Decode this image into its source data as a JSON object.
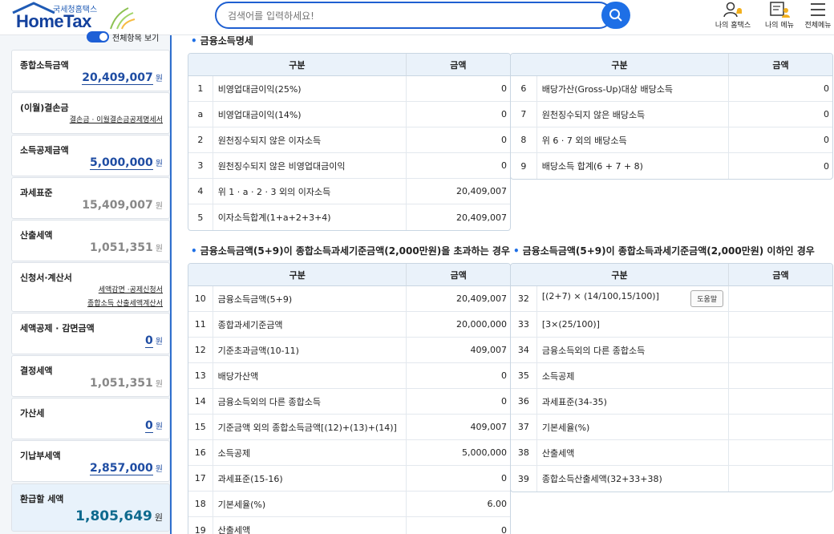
{
  "header": {
    "logo_sub": "국세청홈택스",
    "logo_main": "HomeTax",
    "search_placeholder": "검색어를 입력하세요!",
    "nav": [
      {
        "label": "나의 홈택스",
        "icon": "user-bell-icon"
      },
      {
        "label": "나의 메뉴",
        "icon": "menu-book-user-icon"
      },
      {
        "label": "전체메뉴",
        "icon": "hamburger-menu-icon"
      }
    ]
  },
  "sidebar": {
    "toggle_label": "전체항목 보기",
    "toggle_on": true,
    "cards": [
      {
        "title": "종합소득금액",
        "value": "20,409,007",
        "unit": "원",
        "style": "blue"
      },
      {
        "title": "(이월)결손금",
        "links": [
          "결손금 · 이월결손금공제명세서"
        ]
      },
      {
        "title": "소득공제금액",
        "value": "5,000,000",
        "unit": "원",
        "style": "blue"
      },
      {
        "title": "과세표준",
        "value": "15,409,007",
        "unit": "원",
        "style": "gray"
      },
      {
        "title": "산출세액",
        "value": "1,051,351",
        "unit": "원",
        "style": "gray"
      },
      {
        "title": "신청서·계산서",
        "links": [
          "세액감면 ·공제신청서",
          "종합소득 산출세액계산서"
        ]
      },
      {
        "title": "세액공제 · 감면금액",
        "value": "0",
        "unit": "원",
        "style": "blue"
      },
      {
        "title": "결정세액",
        "value": "1,051,351",
        "unit": "원",
        "style": "gray"
      },
      {
        "title": "가산세",
        "value": "0",
        "unit": "원",
        "style": "blue"
      },
      {
        "title": "기납부세액",
        "value": "2,857,000",
        "unit": "원",
        "style": "blue"
      },
      {
        "title": "환급할 세액",
        "value": "1,805,649",
        "unit": "원",
        "style": "highlight"
      }
    ]
  },
  "main": {
    "section1": {
      "title": "금융소득명세",
      "headers": [
        "구분",
        "금액",
        "구분",
        "금액"
      ],
      "left_rows": [
        {
          "no": "1",
          "label": "비영업대금이익(25%)",
          "amount": "0"
        },
        {
          "no": "a",
          "label": "비영업대금이익(14%)",
          "amount": "0"
        },
        {
          "no": "2",
          "label": "원천징수되지 않은 이자소득",
          "amount": "0"
        },
        {
          "no": "3",
          "label": "원천징수되지 않은 비영업대금이익",
          "amount": "0"
        },
        {
          "no": "4",
          "label": "위 1 · a · 2 · 3 외의 이자소득",
          "amount": "20,409,007"
        },
        {
          "no": "5",
          "label": "이자소득합계(1+a+2+3+4)",
          "amount": "20,409,007"
        }
      ],
      "right_rows": [
        {
          "no": "6",
          "label": "배당가산(Gross-Up)대상 배당소득",
          "amount": "0"
        },
        {
          "no": "7",
          "label": "원천징수되지 않은 배당소득",
          "amount": "0"
        },
        {
          "no": "8",
          "label": "위 6 · 7 외의 배당소득",
          "amount": "0"
        },
        {
          "no": "9",
          "label": "배당소득 합계(6 + 7 + 8)",
          "amount": "0"
        }
      ]
    },
    "section2": {
      "title": "금융소득금액(5+9)이 종합소득과세기준금액(2,000만원)을 초과하는 경우",
      "headers": [
        "구분",
        "금액"
      ],
      "rows": [
        {
          "no": "10",
          "label": "금융소득금액(5+9)",
          "amount": "20,409,007"
        },
        {
          "no": "11",
          "label": "종합과세기준금액",
          "amount": "20,000,000"
        },
        {
          "no": "12",
          "label": "기준초과금액(10-11)",
          "amount": "409,007"
        },
        {
          "no": "13",
          "label": "배당가산액",
          "amount": "0"
        },
        {
          "no": "14",
          "label": "금융소득외의 다른 종합소득",
          "amount": "0"
        },
        {
          "no": "15",
          "label": "기준금액 외의 종합소득금액[(12)+(13)+(14)]",
          "amount": "409,007"
        },
        {
          "no": "16",
          "label": "소득공제",
          "amount": "5,000,000"
        },
        {
          "no": "17",
          "label": "과세표준(15-16)",
          "amount": "0"
        },
        {
          "no": "18",
          "label": "기본세율(%)",
          "amount": "6.00"
        },
        {
          "no": "19",
          "label": "산출세액",
          "amount": "0"
        }
      ]
    },
    "section3": {
      "title": "금융소득금액(5+9)이 종합소득과세기준금액(2,000만원) 이하인 경우",
      "headers": [
        "구분",
        "금액"
      ],
      "help_label": "도움말",
      "rows": [
        {
          "no": "32",
          "label": "[(2+7) × (14/100,15/100)]",
          "amount": ""
        },
        {
          "no": "33",
          "label": "[3×(25/100)]",
          "amount": ""
        },
        {
          "no": "34",
          "label": "금융소득외의 다른 종합소득",
          "amount": ""
        },
        {
          "no": "35",
          "label": "소득공제",
          "amount": ""
        },
        {
          "no": "36",
          "label": "과세표준(34-35)",
          "amount": ""
        },
        {
          "no": "37",
          "label": "기본세율(%)",
          "amount": ""
        },
        {
          "no": "38",
          "label": "산출세액",
          "amount": ""
        },
        {
          "no": "39",
          "label": "종합소득산출세액(32+33+38)",
          "amount": ""
        }
      ]
    }
  }
}
